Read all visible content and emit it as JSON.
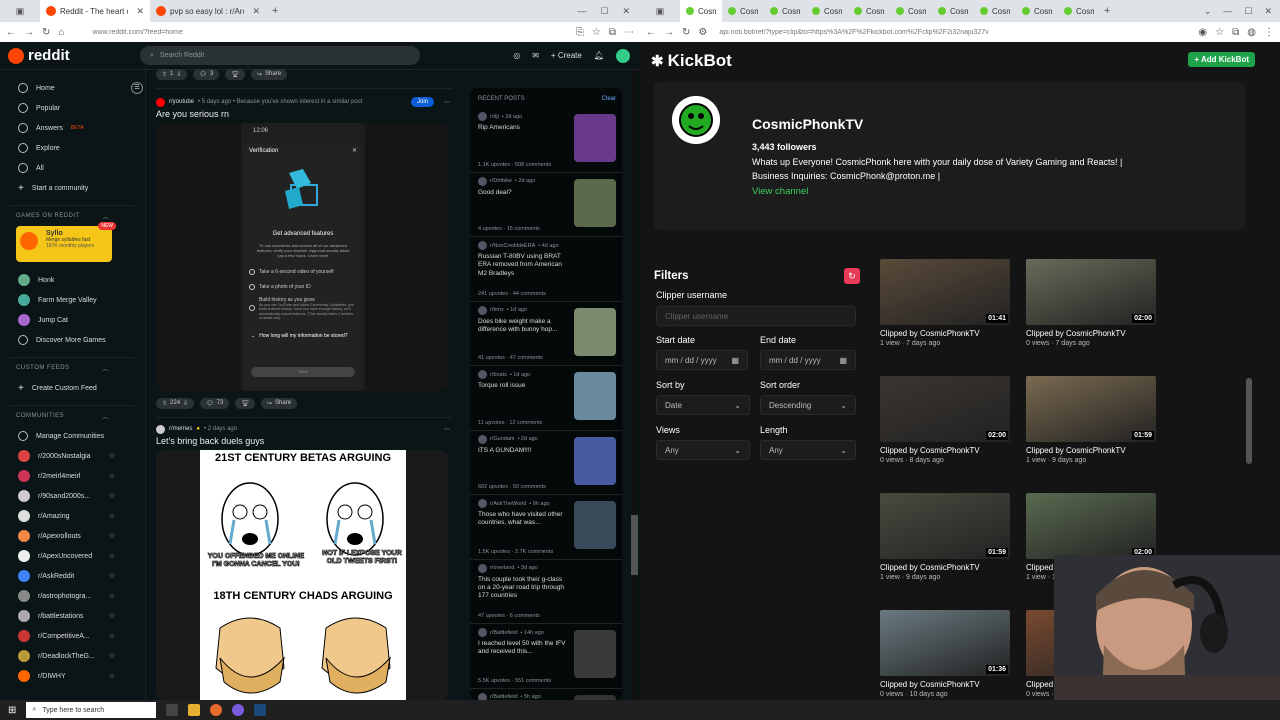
{
  "left_browser": {
    "tabs": [
      {
        "title": "Reddit - The heart of the intern",
        "active": true
      },
      {
        "title": "pvp so easy lol : r/ArcRaiders",
        "active": false
      }
    ],
    "url": "www.reddit.com/?feed=home"
  },
  "reddit": {
    "logo": "reddit",
    "search_placeholder": "Search Reddit",
    "create_label": "Create",
    "sidebar": {
      "nav": [
        {
          "label": "Home",
          "icon": "home-icon"
        },
        {
          "label": "Popular",
          "icon": "popular-icon"
        },
        {
          "label": "Answers",
          "icon": "answers-icon",
          "badge": "BETA"
        },
        {
          "label": "Explore",
          "icon": "explore-icon"
        },
        {
          "label": "All",
          "icon": "all-icon"
        },
        {
          "label": "Start a community",
          "icon": "plus-icon"
        }
      ],
      "games_header": "GAMES ON REDDIT",
      "game_card": {
        "title": "Syllo",
        "subtitle": "Merge syllables fast",
        "players": "187K monthly players",
        "badge": "NEW"
      },
      "games": [
        "Honk",
        "Farm Merge Valley",
        "Jump Cat",
        "Discover More Games"
      ],
      "custom_header": "CUSTOM FEEDS",
      "create_custom": "Create Custom Feed",
      "communities_header": "COMMUNITIES",
      "manage": "Manage Communities",
      "communities": [
        {
          "name": "r/2000sNostalgia",
          "color": "#d44"
        },
        {
          "name": "r/2meirl4meirl",
          "color": "#c35"
        },
        {
          "name": "r/90sand2000s...",
          "color": "#ccc"
        },
        {
          "name": "r/Amazing",
          "color": "#ddd"
        },
        {
          "name": "r/Apexrollouts",
          "color": "#e84"
        },
        {
          "name": "r/ApexUncovered",
          "color": "#eee"
        },
        {
          "name": "r/AskReddit",
          "color": "#3b82f6"
        },
        {
          "name": "r/astrophotogra...",
          "color": "#888"
        },
        {
          "name": "r/battlestations",
          "color": "#aaa"
        },
        {
          "name": "r/CompetitiveA...",
          "color": "#c33"
        },
        {
          "name": "r/DeadlockTheG...",
          "color": "#b93"
        },
        {
          "name": "r/DIWHY",
          "color": "#f60"
        }
      ]
    },
    "top_actions": {
      "votes": "1",
      "comments": "3",
      "share": "Share"
    },
    "post1": {
      "subreddit": "r/youtube",
      "meta": "• 5 days ago • Because you've shown interest in a similar post",
      "join": "Join",
      "title": "Are you serious rn",
      "phone": {
        "time": "12:06",
        "heading": "Verification",
        "features": "Get advanced features",
        "body": "To use comments and access all of our advanced features, verify your channel. Approval usually takes just a few hours. Learn more",
        "options": [
          "Take a 6-second video of yourself",
          "Take a photo of your ID",
          "Build history as you grow"
        ],
        "history_note": "As you use YouTube and follow Community Guidelines, you build channel history. Once you have enough history, we'll automatically unlock features. (This usually takes 2 months of active use)",
        "faq": "How long will my information be stored?",
        "next": "Next"
      },
      "votes": "224",
      "comments": "73",
      "share": "Share"
    },
    "post2": {
      "subreddit": "r/memes",
      "meta": "• 2 days ago",
      "title": "Let's bring back duels guys",
      "meme": {
        "top_title": "21ST CENTURY BETAS ARGUING",
        "left_caption": "YOU OFFENDED ME ONLINE I'M GONNA CANCEL YOU!",
        "right_caption": "NOT IF I EXPOSE YOUR OLD TWEETS FIRST!",
        "bottom_title": "18TH CENTURY CHADS ARGUING"
      }
    },
    "recent": {
      "header": "RECENT POSTS",
      "clear": "Clear",
      "posts": [
        {
          "sub": "r/dji",
          "age": "• 2d ago",
          "title": "Rip Americans",
          "stats": "1.1K upvotes · 508 comments",
          "thumb": "#6a3a8a"
        },
        {
          "sub": "r/Dirtbike",
          "age": "• 2d ago",
          "title": "Good deal?",
          "stats": "4 upvotes · 15 comments",
          "thumb": "#5a6a4a"
        },
        {
          "sub": "r/NonCredibleERA",
          "age": "• 4d ago",
          "title": "Russian T-80BV using BRAT ERA removed from American M2 Bradleys",
          "stats": "241 upvotes · 44 comments",
          "thumb": ""
        },
        {
          "sub": "r/bmx",
          "age": "• 1d ago",
          "title": "Does bike weight make a difference with bunny hop...",
          "stats": "41 upvotes · 47 comments",
          "thumb": "#7a8a6a"
        },
        {
          "sub": "r/boats",
          "age": "• 1d ago",
          "title": "Torque roll issue",
          "stats": "11 upvotes · 12 comments",
          "thumb": "#6a8aa0"
        },
        {
          "sub": "r/Gundam",
          "age": "• 2d ago",
          "title": "ITS A GUNDAM!!!!",
          "stats": "602 upvotes · 50 comments",
          "thumb": "#4a5aa0"
        },
        {
          "sub": "r/AskTheWorld",
          "age": "• 9h ago",
          "title": "Those who have visited other countries, what was...",
          "stats": "1.5K upvotes · 2.7K comments",
          "thumb": "#3a4a5a"
        },
        {
          "sub": "r/overland",
          "age": "• 3d ago",
          "title": "This couple took their g-class on a 20-year road trip through 177 countries",
          "stats": "47 upvotes · 6 comments",
          "thumb": ""
        },
        {
          "sub": "r/Battlefield",
          "age": "• 14h ago",
          "title": "I reached level 50 with the IFV and received this...",
          "stats": "5.5K upvotes · 551 comments",
          "thumb": "#3a3a3a"
        },
        {
          "sub": "r/Battlefield",
          "age": "• 5h ago",
          "title": "",
          "stats": "",
          "thumb": "#333"
        }
      ]
    }
  },
  "right_browser": {
    "tab_label": "Cosmi",
    "url": "api.noti.bot/ref/?type=clip&to=https%3A%2F%2Fkickbot.com%2Fclip%2F2i32naju327v"
  },
  "kickbot": {
    "logo": "KickBot",
    "add_button": "+ Add KickBot",
    "channel": {
      "name": "CosmicPhonkTV",
      "followers": "3,443 followers",
      "bio": "Whats up Everyone! CosmicPhonk here with your daily dose of Variety Gaming and Reacts! | Business Inquiries: CosmicPhonk@proton.me |",
      "view_channel": "View channel"
    },
    "filters": {
      "title": "Filters",
      "clipper_label": "Clipper username",
      "clipper_placeholder": "Clipper username",
      "start_label": "Start date",
      "start_value": "mm / dd / yyyy",
      "end_label": "End date",
      "end_value": "mm / dd / yyyy",
      "sort_by_label": "Sort by",
      "sort_by_value": "Date",
      "sort_order_label": "Sort order",
      "sort_order_value": "Descending",
      "views_label": "Views",
      "views_value": "Any",
      "length_label": "Length",
      "length_value": "Any"
    },
    "clips": [
      {
        "duration": "01:41",
        "by": "Clipped by CosmicPhonkTV",
        "meta": "1 view · 7 days ago",
        "color": "#5a4a3a"
      },
      {
        "duration": "02:00",
        "by": "Clipped by CosmicPhonkTV",
        "meta": "0 views · 7 days ago",
        "color": "#6a6a5a"
      },
      {
        "duration": "02:00",
        "by": "Clipped by CosmicPhonkTV",
        "meta": "0 views · 8 days ago",
        "color": "#3a3530"
      },
      {
        "duration": "01:59",
        "by": "Clipped by CosmicPhonkTV",
        "meta": "1 view · 9 days ago",
        "color": "#7a6a50"
      },
      {
        "duration": "01:59",
        "by": "Clipped by CosmicPhonkTV",
        "meta": "1 view · 9 days ago",
        "color": "#4a4a40"
      },
      {
        "duration": "02:00",
        "by": "Clipped by CosmicPhonkTV",
        "meta": "1 view · 10 days ago",
        "color": "#5a6a50"
      },
      {
        "duration": "01:36",
        "by": "Clipped by CosmicPhonkTV",
        "meta": "0 views · 10 days ago",
        "color": "#6a7a80"
      },
      {
        "duration": "",
        "by": "Clipped by CosmicPhonkTV",
        "meta": "0 views · 10 days ago",
        "color": "#7a4a30"
      }
    ]
  },
  "taskbar": {
    "search_placeholder": "Type here to search"
  }
}
